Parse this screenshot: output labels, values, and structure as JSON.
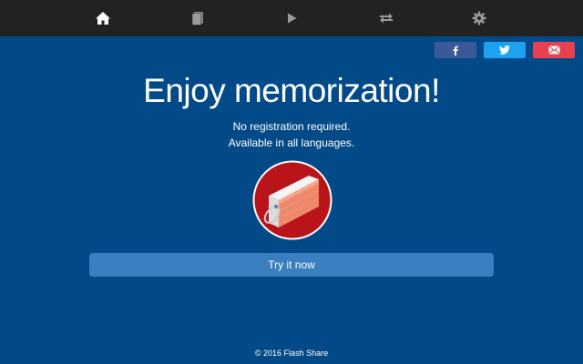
{
  "nav": {
    "items": [
      {
        "name": "home",
        "icon": "home-icon",
        "active": true
      },
      {
        "name": "decks",
        "icon": "cards-icon",
        "active": false
      },
      {
        "name": "play",
        "icon": "play-icon",
        "active": false
      },
      {
        "name": "sync",
        "icon": "transfer-arrows-icon",
        "active": false
      },
      {
        "name": "settings",
        "icon": "gear-icon",
        "active": false
      }
    ]
  },
  "share": {
    "facebook": {
      "icon": "facebook-icon",
      "color": "#3b5998"
    },
    "twitter": {
      "icon": "twitter-icon",
      "color": "#1da1f2"
    },
    "email": {
      "icon": "email-icon",
      "color": "#e8404f"
    }
  },
  "hero": {
    "title": "Enjoy memorization!",
    "line1": "No registration required.",
    "line2": "Available in all languages."
  },
  "logo": {
    "icon": "flashcard-logo-icon"
  },
  "cta": {
    "label": "Try it now"
  },
  "footer": {
    "text": "© 2016 Flash Share"
  },
  "colors": {
    "background": "#024a87",
    "navbar": "#222222",
    "cta": "#3a7fbf",
    "logo_circle": "#b8141a"
  }
}
